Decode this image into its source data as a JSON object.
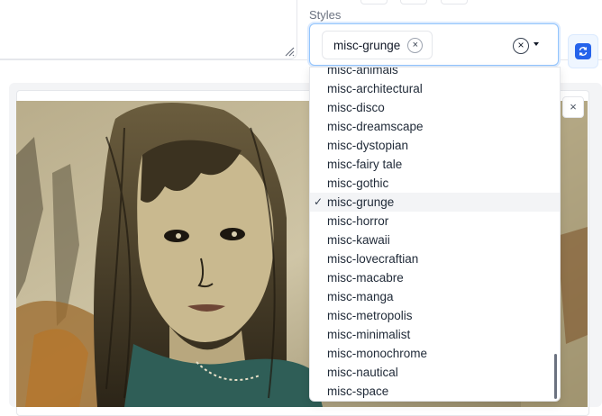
{
  "styles": {
    "label": "Styles",
    "selected_tag": "misc-grunge",
    "tag_remove": "×",
    "clear_symbol": "×"
  },
  "image_panel": {
    "close_symbol": "×"
  },
  "dropdown": {
    "selected": "misc-grunge",
    "items": [
      "misc-animals",
      "misc-architectural",
      "misc-disco",
      "misc-dreamscape",
      "misc-dystopian",
      "misc-fairy tale",
      "misc-gothic",
      "misc-grunge",
      "misc-horror",
      "misc-kawaii",
      "misc-lovecraftian",
      "misc-macabre",
      "misc-manga",
      "misc-metropolis",
      "misc-minimalist",
      "misc-monochrome",
      "misc-nautical",
      "misc-space"
    ],
    "checkmark": "✓"
  },
  "colors": {
    "accent": "#2563eb",
    "focus_border": "#93c5fd"
  },
  "icons": {
    "refresh_button": "refresh-icon",
    "tag_remove": "close-icon",
    "clear": "clear-icon",
    "dropdown": "chevron-down-icon"
  }
}
